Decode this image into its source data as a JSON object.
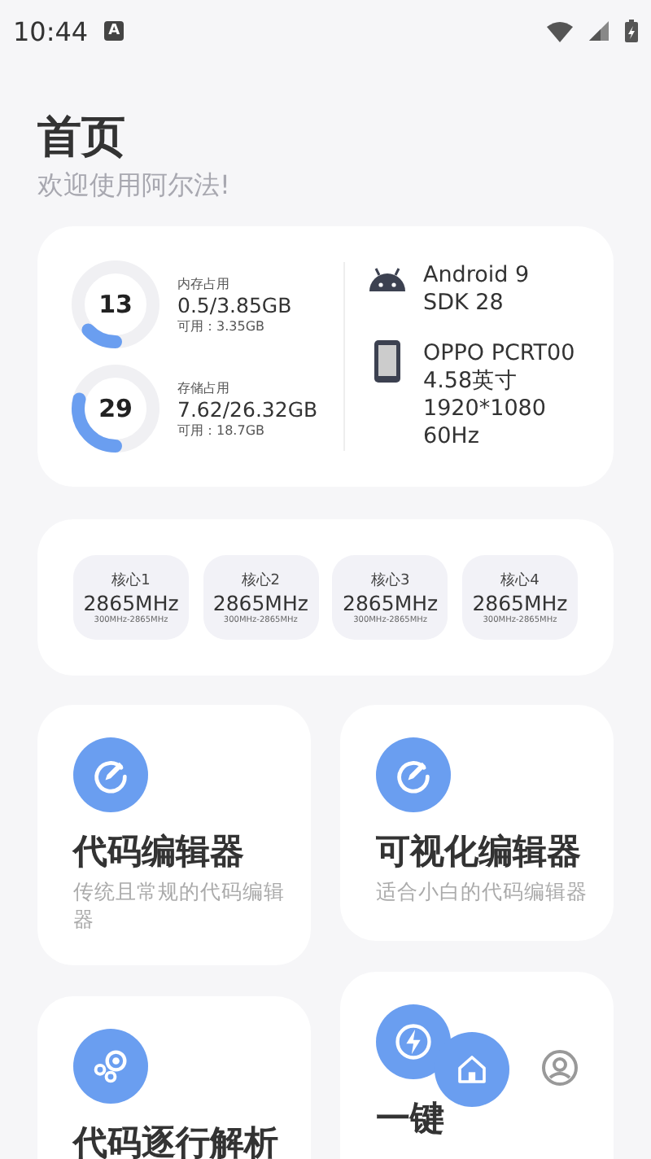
{
  "status_bar": {
    "time": "10:44",
    "notification": "A"
  },
  "header": {
    "title": "首页",
    "subtitle": "欢迎使用阿尔法!"
  },
  "usage": [
    {
      "label": "内存占用",
      "percent": "13",
      "level": 0.13,
      "value": "0.5/3.85GB",
      "available": "可用：3.35GB"
    },
    {
      "label": "存储占用",
      "percent": "29",
      "level": 0.29,
      "value": "7.62/26.32GB",
      "available": "可用：18.7GB"
    }
  ],
  "system": {
    "os": [
      "Android 9",
      "SDK 28"
    ],
    "device": [
      "OPPO PCRT00",
      "4.58英寸",
      "1920*1080",
      "60Hz"
    ]
  },
  "cores": [
    {
      "name": "核心1",
      "frequency": "2865MHz",
      "range": "300MHz-2865MHz"
    },
    {
      "name": "核心2",
      "frequency": "2865MHz",
      "range": "300MHz-2865MHz"
    },
    {
      "name": "核心3",
      "frequency": "2865MHz",
      "range": "300MHz-2865MHz"
    },
    {
      "name": "核心4",
      "frequency": "2865MHz",
      "range": "300MHz-2865MHz"
    }
  ],
  "feature_columns": [
    [
      {
        "kind": "edit",
        "title": "代码编辑器",
        "description": "传统且常规的代码编辑器"
      },
      {
        "kind": "bubbles",
        "title": "代码逐行解析"
      }
    ],
    [
      {
        "kind": "edit",
        "title": "可视化编辑器",
        "description": "适合小白的代码编辑器"
      },
      {
        "kind": "bolt",
        "title": "一键"
      }
    ]
  ],
  "bottom_nav": [
    {
      "kind": "home",
      "selected": true
    },
    {
      "kind": "profile",
      "selected": false
    }
  ]
}
